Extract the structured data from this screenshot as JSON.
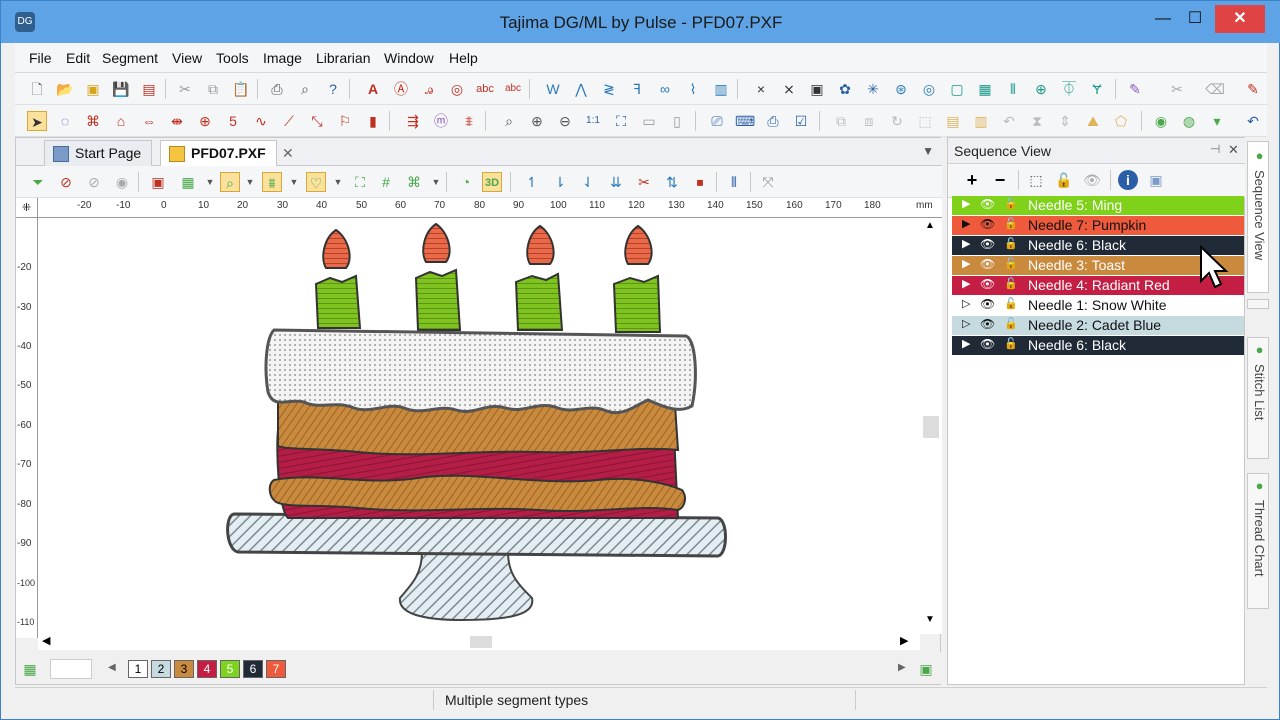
{
  "window": {
    "title": "Tajima DG/ML by Pulse - PFD07.PXF",
    "minimize_label": "—",
    "maximize_label": "☐",
    "close_label": "✕"
  },
  "menu": [
    "File",
    "Edit",
    "Segment",
    "View",
    "Tools",
    "Image",
    "Librarian",
    "Window",
    "Help"
  ],
  "tabs": [
    {
      "label": "Start Page"
    },
    {
      "label": "PFD07.PXF"
    }
  ],
  "ruler": {
    "unit": "mm",
    "h_ticks": [
      "-20",
      "-10",
      "0",
      "10",
      "20",
      "30",
      "40",
      "50",
      "60",
      "70",
      "80",
      "90",
      "100",
      "110",
      "120",
      "130",
      "140",
      "150",
      "160",
      "170",
      "180"
    ],
    "v_ticks": [
      "-20",
      "-30",
      "-40",
      "-50",
      "-60",
      "-70",
      "-80",
      "-90",
      "-100",
      "-110"
    ]
  },
  "color_chips": [
    {
      "label": "1",
      "color": "#ffffff"
    },
    {
      "label": "2",
      "color": "#c6dbe0"
    },
    {
      "label": "3",
      "color": "#c98a3e"
    },
    {
      "label": "4",
      "color": "#c41e45"
    },
    {
      "label": "5",
      "color": "#7ed321"
    },
    {
      "label": "6",
      "color": "#1f2a36"
    },
    {
      "label": "7",
      "color": "#ee5a3b"
    }
  ],
  "sequence_panel": {
    "title": "Sequence View",
    "needles": [
      {
        "label": "Needle 5: Ming",
        "bg": "#7fd11a",
        "fg": "#ffffff"
      },
      {
        "label": "Needle 7: Pumpkin",
        "bg": "#ee5a3b",
        "fg": "#111111"
      },
      {
        "label": "Needle 6: Black",
        "bg": "#1f2a36",
        "fg": "#ffffff"
      },
      {
        "label": "Needle 3: Toast",
        "bg": "#c98a3e",
        "fg": "#ffffff"
      },
      {
        "label": "Needle 4: Radiant Red",
        "bg": "#c41e45",
        "fg": "#ffffff"
      },
      {
        "label": "Needle 1: Snow White",
        "bg": "#ffffff",
        "fg": "#111111"
      },
      {
        "label": "Needle 2: Cadet Blue",
        "bg": "#c6dbe0",
        "fg": "#111111"
      },
      {
        "label": "Needle 6: Black",
        "bg": "#1f2a36",
        "fg": "#ffffff"
      }
    ]
  },
  "side_tabs": [
    "Sequence View",
    "Stitch List",
    "Thread Chart"
  ],
  "status": {
    "message": "Multiple segment types"
  }
}
